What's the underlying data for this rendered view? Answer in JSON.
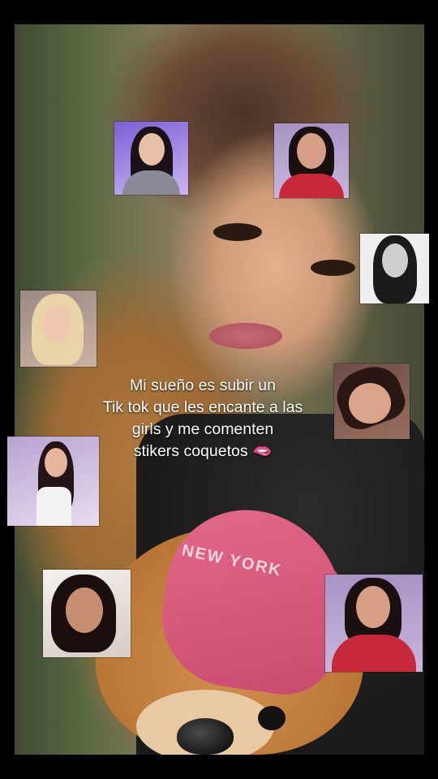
{
  "caption": {
    "line1": "Mi sueño es subir un",
    "line2": "Tik tok que les encante a las",
    "line3": "girls y me comenten",
    "line4": "stikers coquetos 🫦"
  },
  "background": {
    "cap_text": "NEW YORK"
  },
  "colors": {
    "caption_text": "#ffffff",
    "frame": "#000000"
  }
}
